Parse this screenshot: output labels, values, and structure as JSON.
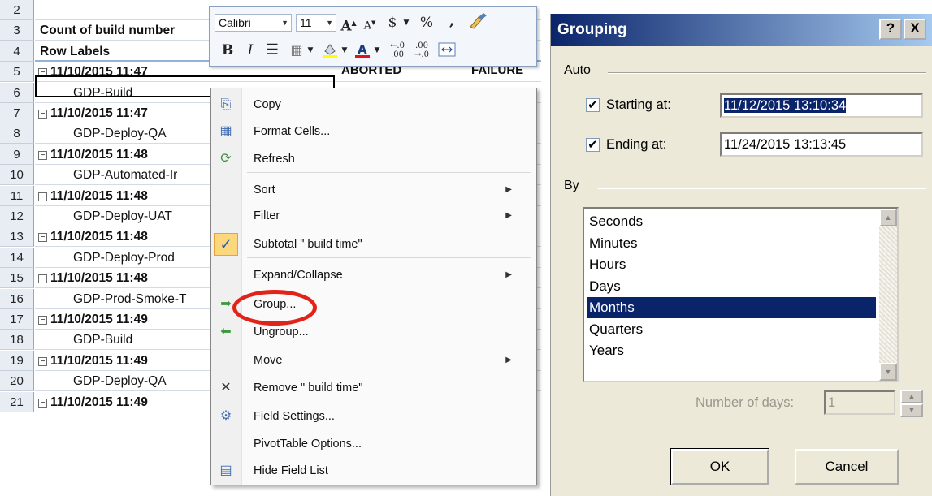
{
  "sheet": {
    "rows": [
      {
        "num": "2",
        "text": "",
        "style": "plain"
      },
      {
        "num": "3",
        "text": "Count of  build number",
        "style": "bold"
      },
      {
        "num": "4",
        "text": "Row Labels",
        "style": "bold"
      },
      {
        "num": "5",
        "text": "11/10/2015 11:47",
        "style": "group"
      },
      {
        "num": "6",
        "text": "GDP-Build",
        "style": "child"
      },
      {
        "num": "7",
        "text": "11/10/2015 11:47",
        "style": "group"
      },
      {
        "num": "8",
        "text": "GDP-Deploy-QA",
        "style": "child"
      },
      {
        "num": "9",
        "text": "11/10/2015 11:48",
        "style": "group"
      },
      {
        "num": "10",
        "text": "GDP-Automated-Ir",
        "style": "child"
      },
      {
        "num": "11",
        "text": "11/10/2015 11:48",
        "style": "group"
      },
      {
        "num": "12",
        "text": "GDP-Deploy-UAT",
        "style": "child"
      },
      {
        "num": "13",
        "text": "11/10/2015 11:48",
        "style": "group"
      },
      {
        "num": "14",
        "text": "GDP-Deploy-Prod",
        "style": "child"
      },
      {
        "num": "15",
        "text": "11/10/2015 11:48",
        "style": "group"
      },
      {
        "num": "16",
        "text": "GDP-Prod-Smoke-T",
        "style": "child"
      },
      {
        "num": "17",
        "text": "11/10/2015 11:49",
        "style": "group"
      },
      {
        "num": "18",
        "text": "GDP-Build",
        "style": "child"
      },
      {
        "num": "19",
        "text": "11/10/2015 11:49",
        "style": "group"
      },
      {
        "num": "20",
        "text": "GDP-Deploy-QA",
        "style": "child"
      },
      {
        "num": "21",
        "text": "11/10/2015 11:49",
        "style": "group"
      }
    ],
    "partial_headers": {
      "aborted": "ABORTED",
      "failure": "FAILURE"
    },
    "collapse_glyph": "−"
  },
  "minitoolbar": {
    "font": "Calibri",
    "size": "11",
    "grow": "A",
    "shrink": "A",
    "currency": "$",
    "percent": "%",
    "comma": ",",
    "bold": "B",
    "italic": "I"
  },
  "context_menu": {
    "items": [
      {
        "label": "Copy",
        "icon": "copy-icon",
        "glyph": "⎘",
        "submenu": false
      },
      {
        "label": "Format Cells...",
        "icon": "format-cells-icon",
        "glyph": "▦",
        "submenu": false
      },
      {
        "label": "Refresh",
        "icon": "refresh-icon",
        "glyph": "⟳",
        "submenu": false
      },
      {
        "label": "Sort",
        "icon": "",
        "glyph": "",
        "submenu": true
      },
      {
        "label": "Filter",
        "icon": "",
        "glyph": "",
        "submenu": true
      },
      {
        "label": "Subtotal \" build time\"",
        "icon": "check-icon",
        "glyph": "✓",
        "submenu": false
      },
      {
        "label": "Expand/Collapse",
        "icon": "",
        "glyph": "",
        "submenu": true
      },
      {
        "label": "Group...",
        "icon": "group-arrow-icon",
        "glyph": "➡",
        "submenu": false
      },
      {
        "label": "Ungroup...",
        "icon": "ungroup-arrow-icon",
        "glyph": "⬅",
        "submenu": false
      },
      {
        "label": "Move",
        "icon": "",
        "glyph": "",
        "submenu": true
      },
      {
        "label": "Remove \" build time\"",
        "icon": "remove-icon",
        "glyph": "✕",
        "submenu": false
      },
      {
        "label": "Field Settings...",
        "icon": "field-settings-icon",
        "glyph": "⚙",
        "submenu": false
      },
      {
        "label": "PivotTable Options...",
        "icon": "",
        "glyph": "",
        "submenu": false
      },
      {
        "label": "Hide Field List",
        "icon": "field-list-icon",
        "glyph": "▤",
        "submenu": false
      }
    ],
    "submenu_glyph": "▶"
  },
  "dialog": {
    "title": "Grouping",
    "help_btn": "?",
    "close_btn": "X",
    "auto_label": "Auto",
    "starting_label": "Starting at:",
    "starting_checked": "✔",
    "starting_value": "11/12/2015 13:10:34",
    "ending_label": "Ending at:",
    "ending_checked": "✔",
    "ending_value": "11/24/2015 13:13:45",
    "by_label": "By",
    "by_options": [
      "Seconds",
      "Minutes",
      "Hours",
      "Days",
      "Months",
      "Quarters",
      "Years"
    ],
    "by_selected": "Months",
    "days_label": "Number of days:",
    "days_value": "1",
    "ok": "OK",
    "cancel": "Cancel"
  }
}
